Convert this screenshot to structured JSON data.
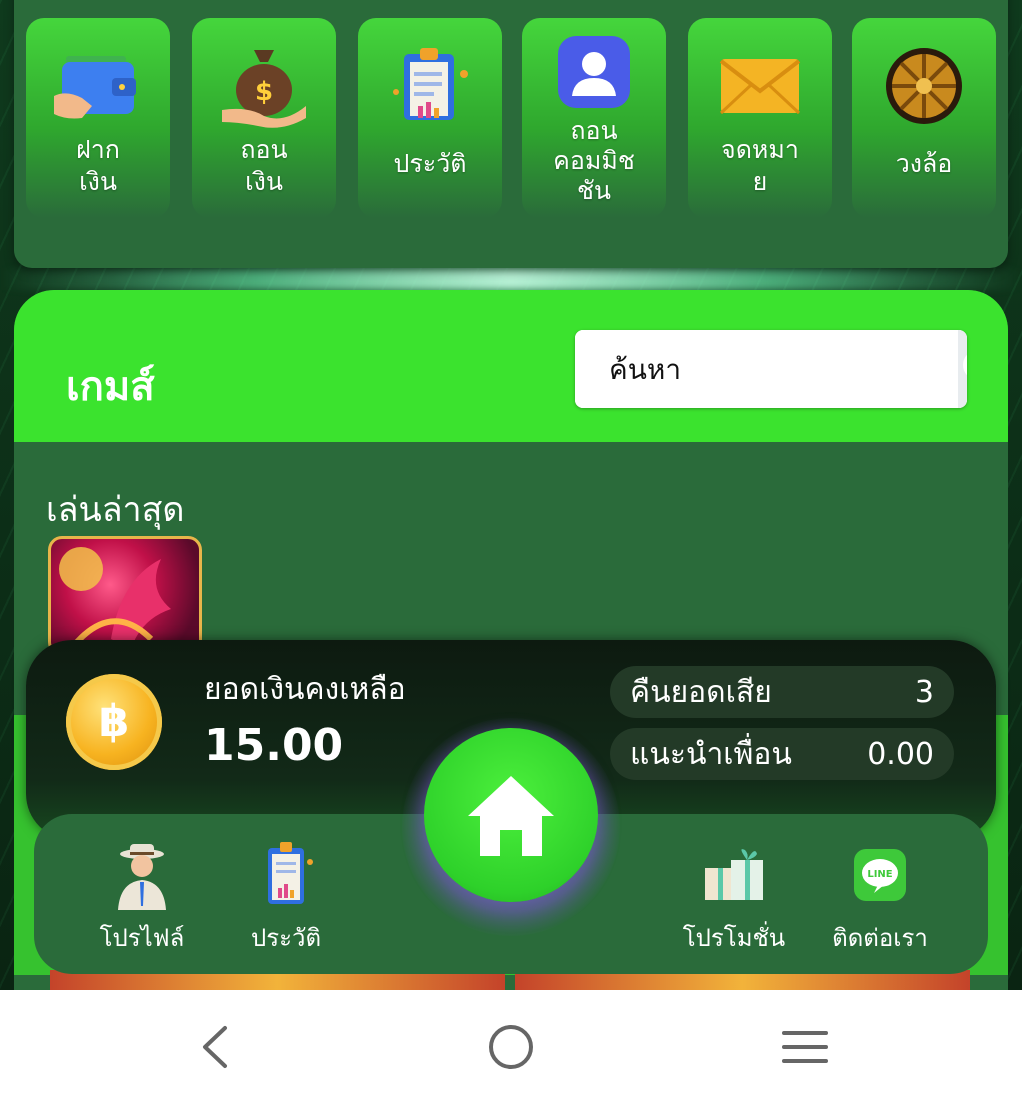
{
  "quick_menu": {
    "items": [
      {
        "label": "ฝาก\nเงิน",
        "icon": "wallet-icon"
      },
      {
        "label": "ถอน\nเงิน",
        "icon": "money-bag-icon"
      },
      {
        "label": "ประวัติ",
        "icon": "clipboard-icon"
      },
      {
        "label": "ถอน\nคอมมิช\nชัน",
        "icon": "user-icon"
      },
      {
        "label": "จดหมา\nย",
        "icon": "envelope-icon"
      },
      {
        "label": "วงล้อ",
        "icon": "wheel-icon"
      }
    ]
  },
  "games": {
    "title": "เกมส์",
    "search_placeholder": "ค้นหา",
    "recent_label": "เล่นล่าสุด"
  },
  "balance": {
    "label": "ยอดเงินคงเหลือ",
    "value": "15.00",
    "rebate_label": "คืนยอดเสีย",
    "rebate_value": "3",
    "referral_label": "แนะนำเพื่อน",
    "referral_value": "0.00"
  },
  "bottom_nav": {
    "profile": "โปรไฟล์",
    "history": "ประวัติ",
    "promotion": "โปรโมชั่น",
    "contact": "ติดต่อเรา"
  },
  "colors": {
    "bright_green": "#3be32e",
    "panel_green": "#2a6b3a",
    "dark_card": "#0d1a10"
  }
}
